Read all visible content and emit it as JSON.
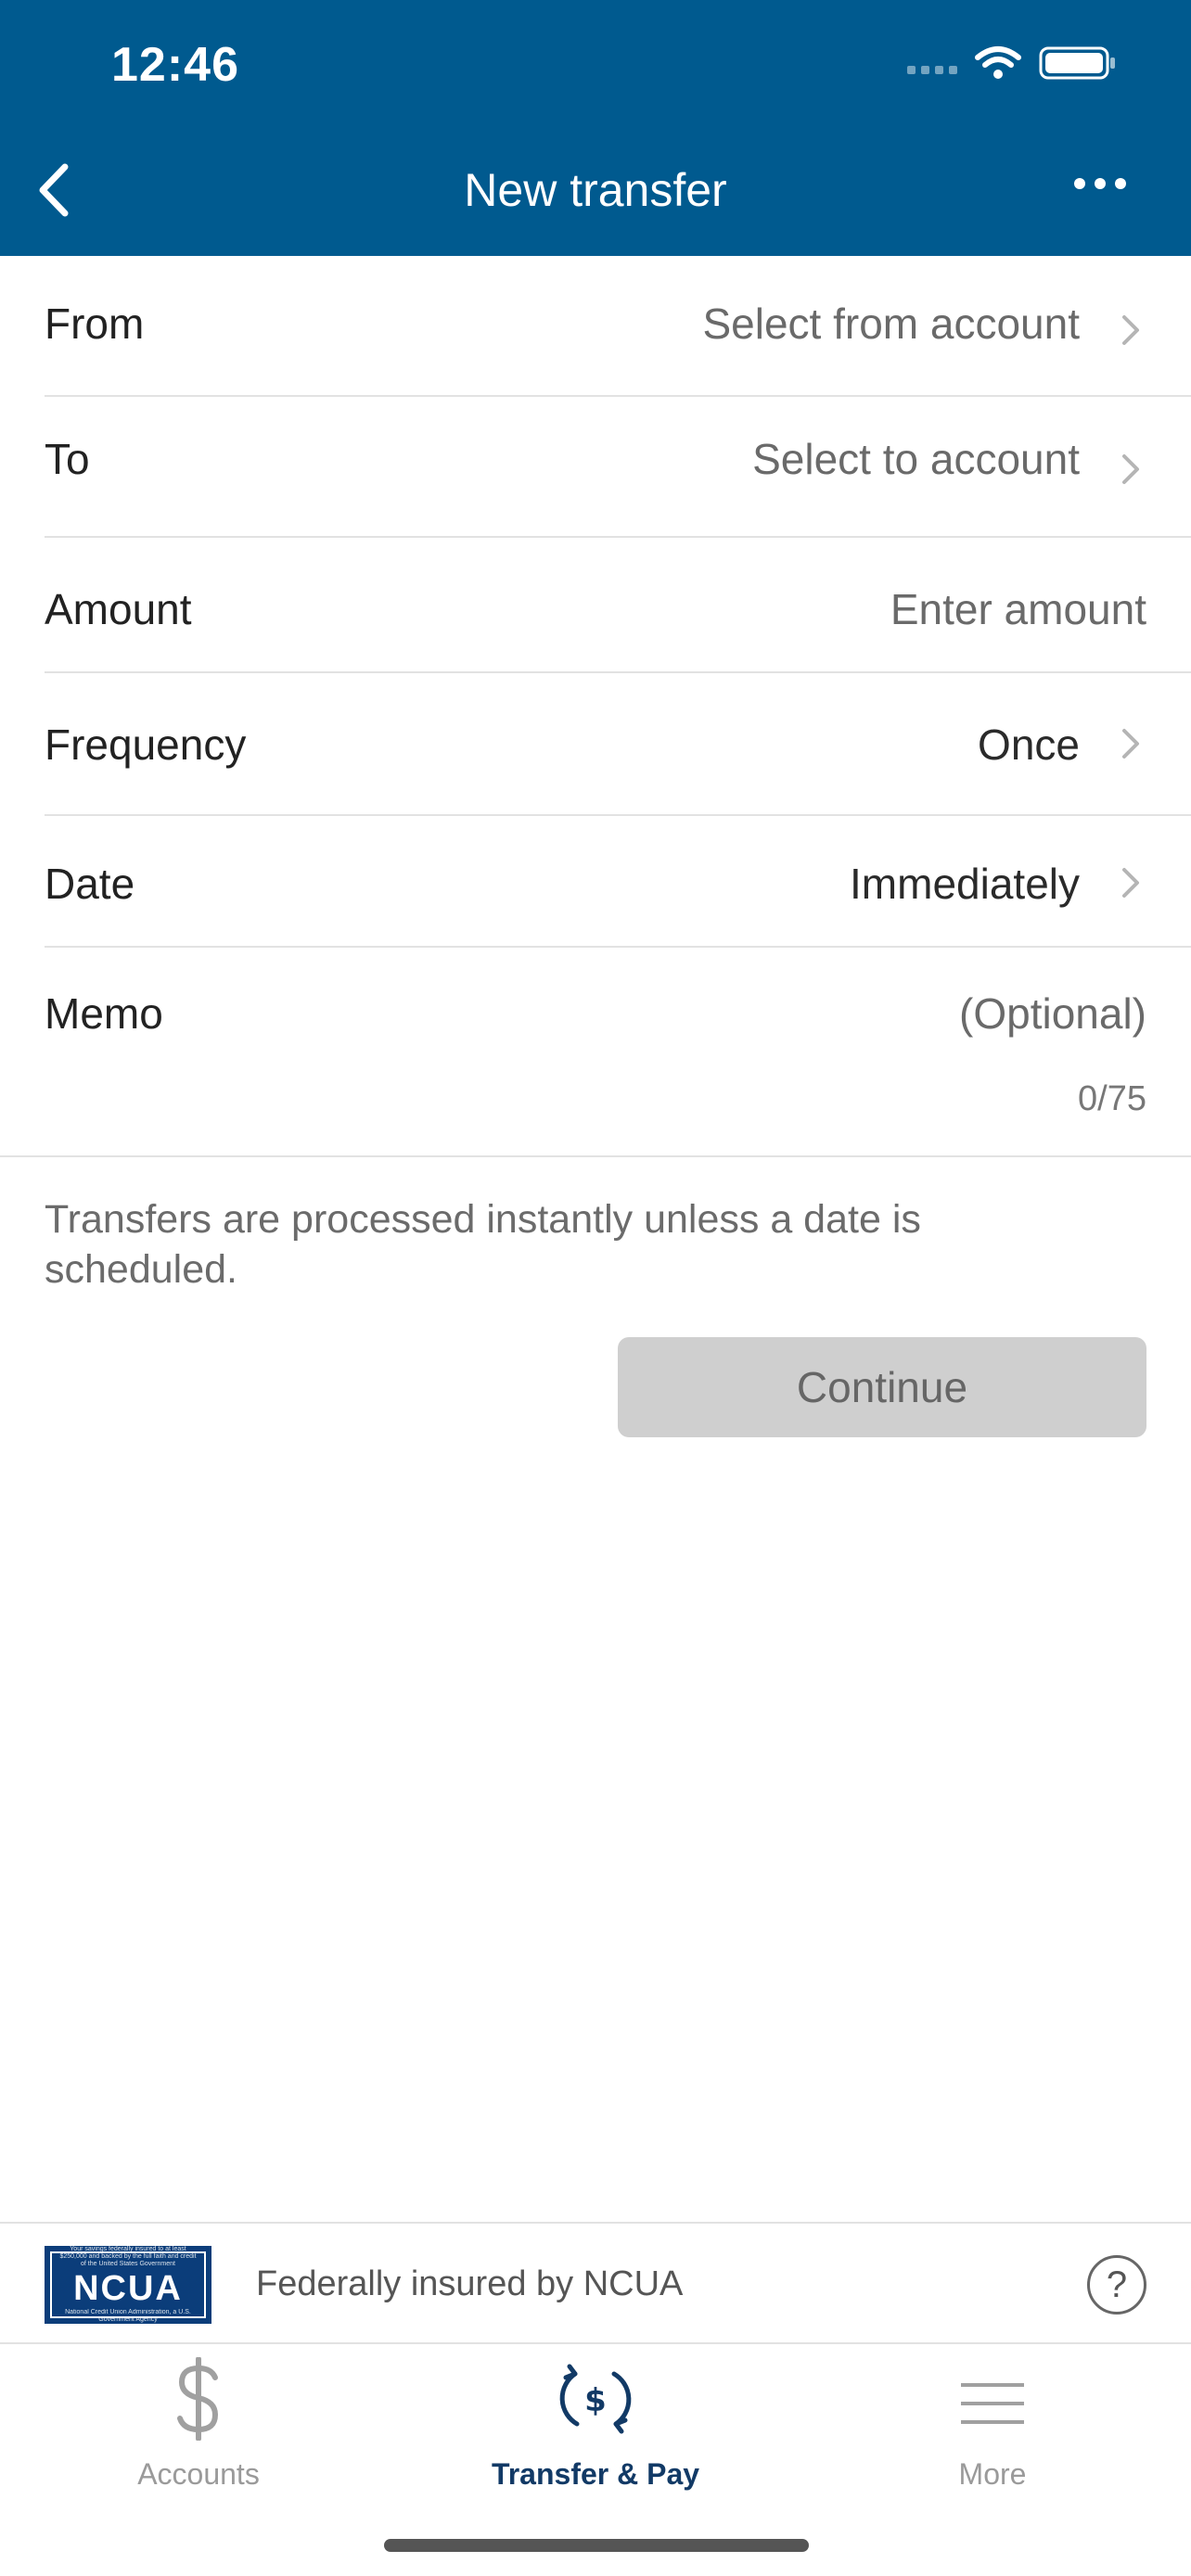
{
  "status_bar": {
    "time": "12:46"
  },
  "nav": {
    "title": "New transfer"
  },
  "form": {
    "from": {
      "label": "From",
      "value": "Select from account"
    },
    "to": {
      "label": "To",
      "value": "Select to account"
    },
    "amount": {
      "label": "Amount",
      "placeholder": "Enter amount"
    },
    "frequency": {
      "label": "Frequency",
      "value": "Once"
    },
    "date": {
      "label": "Date",
      "value": "Immediately"
    },
    "memo": {
      "label": "Memo",
      "placeholder": "(Optional)",
      "counter": "0/75"
    }
  },
  "note": "Transfers are processed instantly unless a date is scheduled.",
  "continue_label": "Continue",
  "insured": {
    "logo_text": "NCUA",
    "logo_fine_print": "Your savings federally insured to at least $250,000 and backed by the full faith and credit of the United States Government",
    "logo_footer": "National Credit Union Administration, a U.S. Government Agency",
    "text": "Federally insured by NCUA",
    "help_symbol": "?"
  },
  "tabs": [
    {
      "label": "Accounts",
      "icon": "dollar-icon",
      "active": false
    },
    {
      "label": "Transfer & Pay",
      "icon": "transfer-dollar-icon",
      "active": true
    },
    {
      "label": "More",
      "icon": "menu-icon",
      "active": false
    }
  ],
  "colors": {
    "header": "#005a8f",
    "active_tab": "#123a66",
    "disabled_button": "#cfcfcf"
  }
}
